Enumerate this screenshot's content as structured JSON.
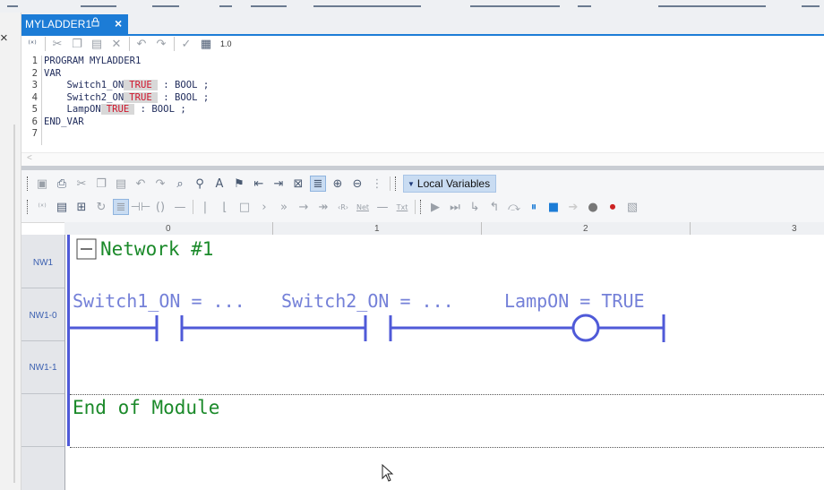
{
  "window": {
    "close_glyph": "×"
  },
  "tab": {
    "title": "MYLADDER1",
    "lock_icon": "lock-icon",
    "close_glyph": "×"
  },
  "code_toolbar": {
    "version_label": "1.0"
  },
  "code": {
    "lines": [
      {
        "num": "1",
        "text": "PROGRAM MYLADDER1"
      },
      {
        "num": "2",
        "text": "VAR"
      },
      {
        "num": "3",
        "pre": "    Switch1_ON",
        "val": "TRUE",
        "post": " : BOOL ;"
      },
      {
        "num": "4",
        "pre": "    Switch2_ON",
        "val": "TRUE",
        "post": " : BOOL ;"
      },
      {
        "num": "5",
        "pre": "    LampON",
        "val": "TRUE",
        "post": " : BOOL ;"
      },
      {
        "num": "6",
        "text": "END_VAR"
      },
      {
        "num": "7",
        "text": ""
      }
    ],
    "scroll_left_glyph": "<"
  },
  "ladder_toolbar": {
    "local_variables_label": "Local Variables"
  },
  "ruler": {
    "columns": [
      "0",
      "1",
      "2",
      "3"
    ]
  },
  "row_headers": [
    "NW1",
    "NW1-0",
    "NW1-1"
  ],
  "ladder": {
    "network_title": "Network #1",
    "collapse_glyph": "−",
    "contact1_label": "Switch1_ON = ...",
    "contact2_label": "Switch2_ON = ...",
    "coil_label": "LampON = TRUE",
    "end_label": "End of Module"
  },
  "colors": {
    "accent": "#1c7cd6",
    "value_red": "#d0162d",
    "ladder_line": "#4f5ad8",
    "network_green": "#1b8a2a"
  }
}
